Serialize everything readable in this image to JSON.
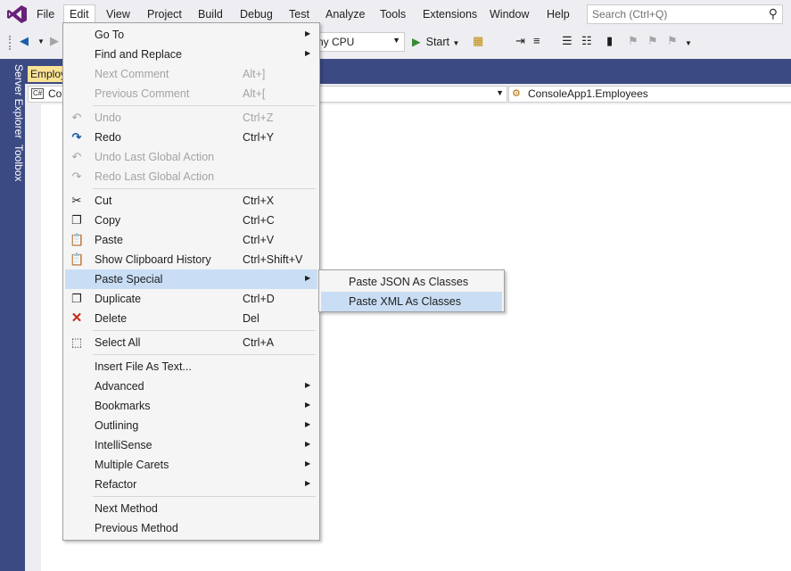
{
  "menubar": {
    "items": [
      "File",
      "Edit",
      "View",
      "Project",
      "Build",
      "Debug",
      "Test",
      "Analyze",
      "Tools",
      "Extensions",
      "Window",
      "Help"
    ],
    "search_placeholder": "Search (Ctrl+Q)"
  },
  "toolbar": {
    "platform": "ny CPU",
    "start_label": "Start"
  },
  "side_tabs": [
    "Server Explorer",
    "Toolbox"
  ],
  "document_tab": "Employ",
  "navbar": {
    "left_text": "Cor",
    "right_text": "ConsoleApp1.Employees"
  },
  "edit_menu": {
    "go_to": {
      "label": "Go To"
    },
    "find_replace": {
      "label": "Find and Replace"
    },
    "next_comment": {
      "label": "Next Comment",
      "shortcut": "Alt+]"
    },
    "prev_comment": {
      "label": "Previous Comment",
      "shortcut": "Alt+["
    },
    "undo": {
      "label": "Undo",
      "shortcut": "Ctrl+Z"
    },
    "redo": {
      "label": "Redo",
      "shortcut": "Ctrl+Y"
    },
    "undo_global": {
      "label": "Undo Last Global Action"
    },
    "redo_global": {
      "label": "Redo Last Global Action"
    },
    "cut": {
      "label": "Cut",
      "shortcut": "Ctrl+X"
    },
    "copy": {
      "label": "Copy",
      "shortcut": "Ctrl+C"
    },
    "paste": {
      "label": "Paste",
      "shortcut": "Ctrl+V"
    },
    "clipboard_history": {
      "label": "Show Clipboard History",
      "shortcut": "Ctrl+Shift+V"
    },
    "paste_special": {
      "label": "Paste Special"
    },
    "duplicate": {
      "label": "Duplicate",
      "shortcut": "Ctrl+D"
    },
    "delete": {
      "label": "Delete",
      "shortcut": "Del"
    },
    "select_all": {
      "label": "Select All",
      "shortcut": "Ctrl+A"
    },
    "insert_file": {
      "label": "Insert File As Text..."
    },
    "advanced": {
      "label": "Advanced"
    },
    "bookmarks": {
      "label": "Bookmarks"
    },
    "outlining": {
      "label": "Outlining"
    },
    "intellisense": {
      "label": "IntelliSense"
    },
    "multiple_carets": {
      "label": "Multiple Carets"
    },
    "refactor": {
      "label": "Refactor"
    },
    "next_method": {
      "label": "Next Method"
    },
    "prev_method": {
      "label": "Previous Method"
    }
  },
  "paste_special_submenu": {
    "json": "Paste JSON As Classes",
    "xml": "Paste XML As Classes"
  },
  "colors": {
    "accent_band": "#3c4a84",
    "menu_highlight": "#c9def5",
    "doc_tab": "#fbe395",
    "vs_logo": "#68217a"
  }
}
